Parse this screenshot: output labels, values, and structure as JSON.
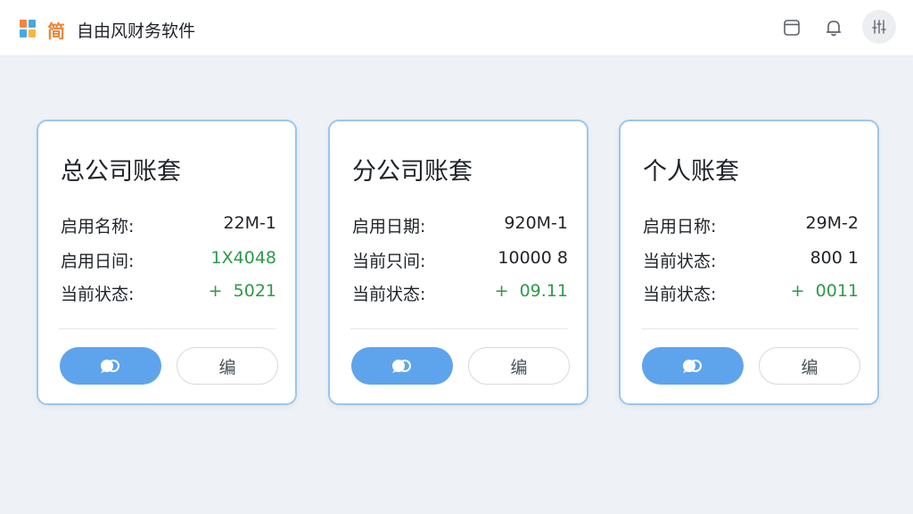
{
  "app": {
    "brand_char": "简",
    "title": "自由风财务软件"
  },
  "topbar_icons": [
    "window-icon",
    "bell-icon",
    "settings-sliders-icon"
  ],
  "colors": {
    "accent": "#5ea4ec",
    "card_border": "#9cc6ec",
    "value_green": "#2c9a4a",
    "background": "#eef1f6"
  },
  "cards": [
    {
      "title": "总公司账套",
      "rows": [
        {
          "label": "启用名称:",
          "value": "22M-1"
        },
        {
          "label": "启用日间:",
          "value": "1X4048"
        },
        {
          "label": "当前状态:",
          "value": "+  5021"
        }
      ],
      "primary_icon": "chat-bubbles-icon",
      "secondary_label": "编"
    },
    {
      "title": "分公司账套",
      "rows": [
        {
          "label": "启用日期:",
          "value": "920M-1"
        },
        {
          "label": "当前只间:",
          "value": "10000 8"
        },
        {
          "label": "当前状态:",
          "value": "+  09.11"
        }
      ],
      "primary_icon": "chat-bubbles-icon",
      "secondary_label": "编"
    },
    {
      "title": "个人账套",
      "rows": [
        {
          "label": "启用日称:",
          "value": "29M-2"
        },
        {
          "label": "当前状态:",
          "value": "800 1"
        },
        {
          "label": "当前状态:",
          "value": "+  0011"
        }
      ],
      "primary_icon": "chat-bubbles-icon",
      "secondary_label": "编"
    }
  ]
}
